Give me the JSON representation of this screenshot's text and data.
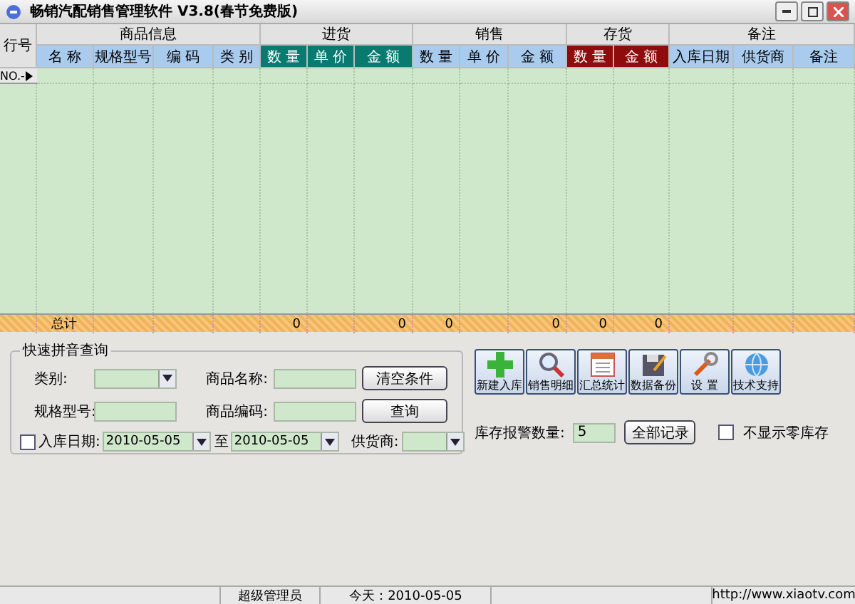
{
  "window": {
    "title": "畅销汽配销售管理软件 V3.8(春节免费版)"
  },
  "table": {
    "row_header": "行号",
    "row_marker": "NO.-",
    "total_label": "总计",
    "groups": [
      {
        "label": "商品信息",
        "kind": "plain",
        "columns": [
          {
            "label": "名 称"
          },
          {
            "label": "规格型号"
          },
          {
            "label": "编 码"
          },
          {
            "label": "类 别"
          }
        ]
      },
      {
        "label": "进货",
        "kind": "teal",
        "columns": [
          {
            "label": "数 量",
            "total": "0"
          },
          {
            "label": "单 价"
          },
          {
            "label": "金 额",
            "total": "0"
          }
        ]
      },
      {
        "label": "销售",
        "kind": "plain",
        "columns": [
          {
            "label": "数 量",
            "total": "0"
          },
          {
            "label": "单 价"
          },
          {
            "label": "金 额",
            "total": "0"
          }
        ]
      },
      {
        "label": "存货",
        "kind": "red",
        "columns": [
          {
            "label": "数 量",
            "total": "0"
          },
          {
            "label": "金 额",
            "total": "0"
          }
        ]
      },
      {
        "label": "备注",
        "kind": "plain",
        "columns": [
          {
            "label": "入库日期"
          },
          {
            "label": "供货商"
          },
          {
            "label": "备注"
          }
        ]
      }
    ]
  },
  "search": {
    "legend": "快速拼音查询",
    "category": {
      "label": "类别:"
    },
    "product_name": {
      "label": "商品名称:"
    },
    "clear_button": "清空条件",
    "model": {
      "label": "规格型号:"
    },
    "product_code": {
      "label": "商品编码:"
    },
    "query_button": "查询",
    "date_filter": {
      "label": "入库日期:",
      "checked": false,
      "from": "2010-05-05",
      "to_label": "至",
      "to": "2010-05-05"
    },
    "supplier": {
      "label": "供货商:"
    }
  },
  "toolbar": [
    {
      "label": "新建入库",
      "kind": "plus"
    },
    {
      "label": "销售明细",
      "kind": "magnifier"
    },
    {
      "label": "汇总统计",
      "kind": "calendar"
    },
    {
      "label": "数据备份",
      "kind": "floppy"
    },
    {
      "label": "设 置",
      "kind": "wrench"
    },
    {
      "label": "技术支持",
      "kind": "globe"
    }
  ],
  "stock_alert": {
    "label": "库存报警数量:",
    "value": "5"
  },
  "all_records_button": "全部记录",
  "hide_zero_stock": {
    "label": "不显示零库存",
    "checked": false
  },
  "status_bar": {
    "user": "超级管理员",
    "today": "今天：2010-05-05",
    "url": "http://www.xiaotv.com"
  }
}
